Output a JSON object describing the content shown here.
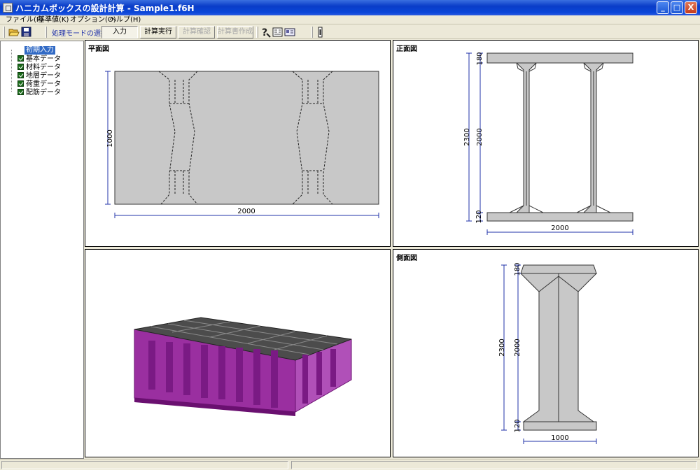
{
  "window": {
    "title": "ハニカムボックスの設計計算 - Sample1.f6H",
    "controls": {
      "minimize": "_",
      "maximize": "□",
      "close": "X"
    }
  },
  "menu": [
    "ファイル(F)",
    "基準値(K)",
    "オプション(O)",
    "ヘルプ(H)"
  ],
  "toolbar": {
    "mode_label": "処理モードの選択",
    "buttons": [
      {
        "label": "入力",
        "state": "pressed"
      },
      {
        "label": "計算実行",
        "state": "enabled"
      },
      {
        "label": "計算確認",
        "state": "disabled"
      },
      {
        "label": "計算書作成",
        "state": "disabled"
      }
    ],
    "icons": [
      "open-folder-icon",
      "save-icon",
      "help-icon",
      "book-icon",
      "card-icon",
      "info-icon"
    ]
  },
  "tree": {
    "root": "初期入力",
    "items": [
      "基本データ",
      "材料データ",
      "地層データ",
      "荷重データ",
      "配筋データ"
    ]
  },
  "views": {
    "plan": {
      "title": "平面図",
      "width_label": "2000",
      "height_label": "1000"
    },
    "front": {
      "title": "正面図",
      "top_label": "180",
      "total_label": "2300",
      "mid_label": "2000",
      "bottom_label": "120",
      "width_label": "2000"
    },
    "perspective": {
      "title": ""
    },
    "side": {
      "title": "側面図",
      "top_label": "180",
      "total_label": "2300",
      "mid_label": "2000",
      "bottom_label": "120",
      "width_label": "1000"
    }
  },
  "colors": {
    "concrete": "#c8c8c8",
    "dimension": "#2233aa",
    "model_purple": "#9a2fa0",
    "model_top": "#505050"
  }
}
